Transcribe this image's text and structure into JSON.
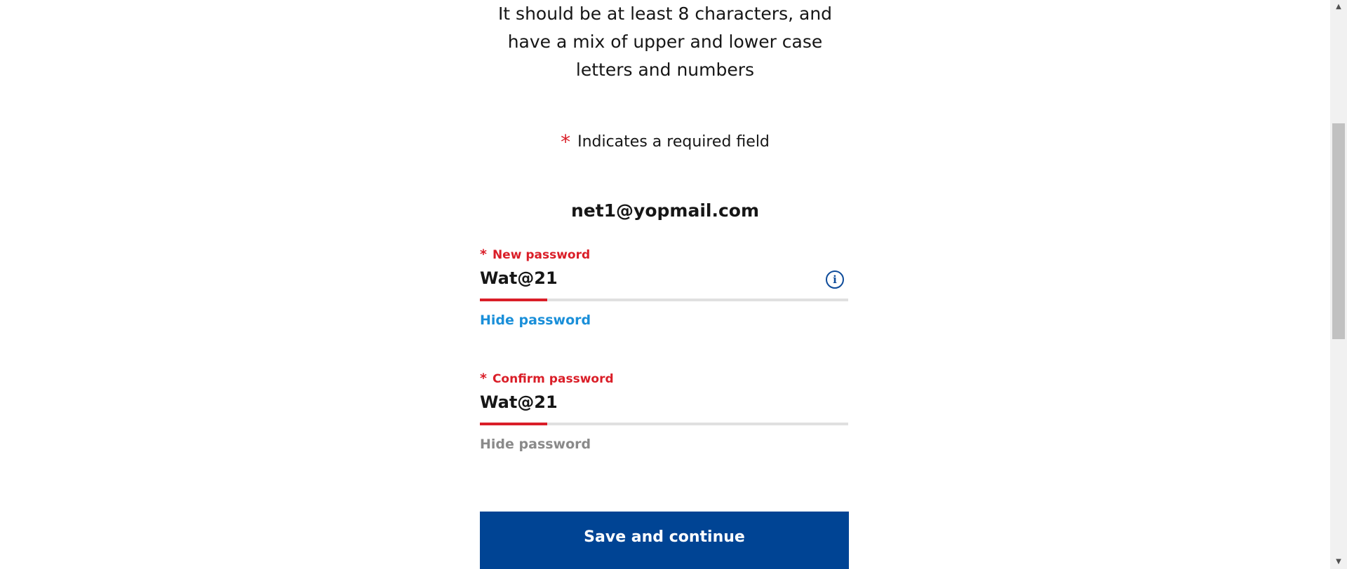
{
  "intro": {
    "text": "It should be at least 8 characters, and have a mix of upper and lower case letters and numbers"
  },
  "required_note": {
    "star": "*",
    "text": "Indicates a required field"
  },
  "account": {
    "email": "net1@yopmail.com"
  },
  "new_password": {
    "star": "*",
    "label": "New password",
    "value": "Wat@21",
    "toggle_label": "Hide password",
    "info_icon": "i"
  },
  "confirm_password": {
    "star": "*",
    "label": "Confirm password",
    "value": "Wat@21",
    "toggle_label": "Hide password"
  },
  "actions": {
    "save_label": "Save and continue"
  },
  "scrollbar": {
    "up_arrow": "▲",
    "down_arrow": "▼"
  },
  "colors": {
    "required": "#da1e28",
    "link": "#1a8fd9",
    "primary_button": "#004494",
    "info_icon": "#0f4c9a"
  }
}
